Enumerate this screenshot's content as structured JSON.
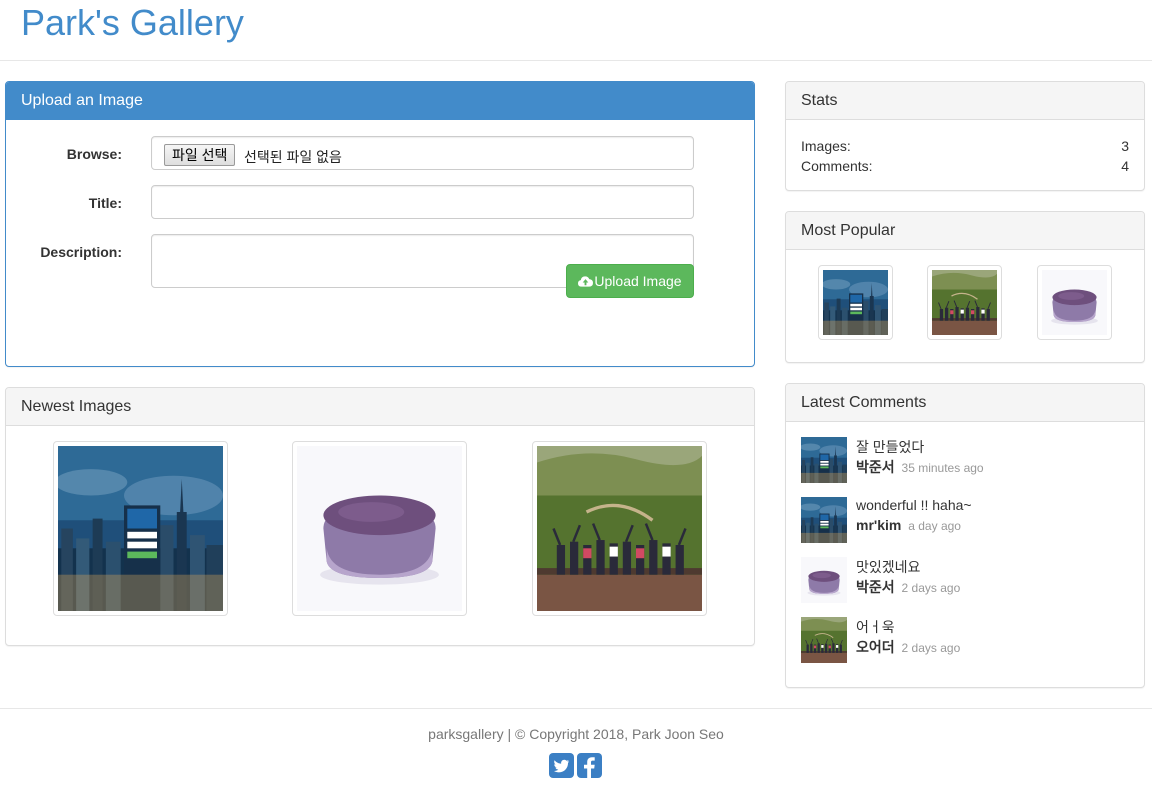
{
  "header": {
    "title": "Park's Gallery"
  },
  "upload": {
    "heading": "Upload an Image",
    "browse_label": "Browse:",
    "file_button_label": "파일 선택",
    "file_status": "선택된 파일 없음",
    "title_label": "Title:",
    "title_value": "",
    "description_label": "Description:",
    "description_value": "",
    "submit_label": "Upload Image",
    "submit_icon": "cloud-upload-icon",
    "accent_color": "#428bca",
    "submit_color": "#5cb85c"
  },
  "newest": {
    "heading": "Newest Images",
    "images": [
      {
        "icon": "city-skyline-login-image"
      },
      {
        "icon": "purple-cake-image"
      },
      {
        "icon": "group-photo-image"
      }
    ]
  },
  "stats": {
    "heading": "Stats",
    "rows": [
      {
        "label": "Images:",
        "value": "3"
      },
      {
        "label": "Comments:",
        "value": "4"
      }
    ]
  },
  "popular": {
    "heading": "Most Popular",
    "images": [
      {
        "icon": "city-skyline-login-image"
      },
      {
        "icon": "group-photo-image"
      },
      {
        "icon": "purple-cake-image"
      }
    ]
  },
  "comments": {
    "heading": "Latest Comments",
    "items": [
      {
        "text": "잘 만들었다",
        "author": "박준서",
        "time": "35 minutes ago",
        "icon": "city-skyline-login-image"
      },
      {
        "text": "wonderful !! haha~",
        "author": "mr'kim",
        "time": "a day ago",
        "icon": "city-skyline-login-image"
      },
      {
        "text": "맛있겠네요",
        "author": "박준서",
        "time": "2 days ago",
        "icon": "purple-cake-image"
      },
      {
        "text": "어ㅓ욱",
        "author": "오어더",
        "time": "2 days ago",
        "icon": "group-photo-image"
      }
    ]
  },
  "footer": {
    "text": "parksgallery | © Copyright 2018, Park Joon Seo",
    "social": [
      {
        "icon": "twitter-icon"
      },
      {
        "icon": "facebook-icon"
      }
    ],
    "social_color": "#3b7fc4"
  }
}
